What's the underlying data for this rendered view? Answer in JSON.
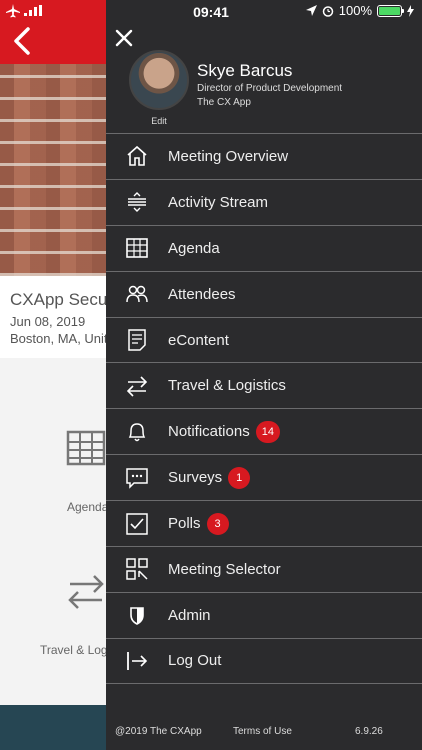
{
  "status_bar": {
    "time": "09:41",
    "battery": "100%"
  },
  "background": {
    "event_title": "CXApp Secur",
    "event_date": "Jun 08, 2019",
    "event_location": "Boston, MA, Unite",
    "tile_agenda": "Agenda",
    "tile_travel": "Travel & Log"
  },
  "profile": {
    "name": "Skye Barcus",
    "role": "Director of Product Development",
    "org": "The CX App",
    "edit_label": "Edit"
  },
  "menu": {
    "items": [
      {
        "label": "Meeting Overview",
        "icon": "home-icon"
      },
      {
        "label": "Activity Stream",
        "icon": "activity-stream-icon"
      },
      {
        "label": "Agenda",
        "icon": "grid-icon"
      },
      {
        "label": "Attendees",
        "icon": "people-icon"
      },
      {
        "label": "eContent",
        "icon": "document-icon"
      },
      {
        "label": "Travel & Logistics",
        "icon": "swap-arrows-icon"
      },
      {
        "label": "Notifications",
        "icon": "bell-icon",
        "badge": "14"
      },
      {
        "label": "Surveys",
        "icon": "chat-bubble-icon",
        "badge": "1"
      },
      {
        "label": "Polls",
        "icon": "checkbox-icon",
        "badge": "3"
      },
      {
        "label": "Meeting Selector",
        "icon": "qr-code-icon"
      },
      {
        "label": "Admin",
        "icon": "shield-icon"
      },
      {
        "label": "Log Out",
        "icon": "logout-icon"
      }
    ]
  },
  "footer": {
    "copyright": "@2019 The CXApp",
    "terms": "Terms of Use",
    "version": "6.9.26"
  },
  "colors": {
    "accent_red": "#d71920",
    "drawer_bg": "#2b2b2d",
    "battery_green": "#4cd964"
  }
}
